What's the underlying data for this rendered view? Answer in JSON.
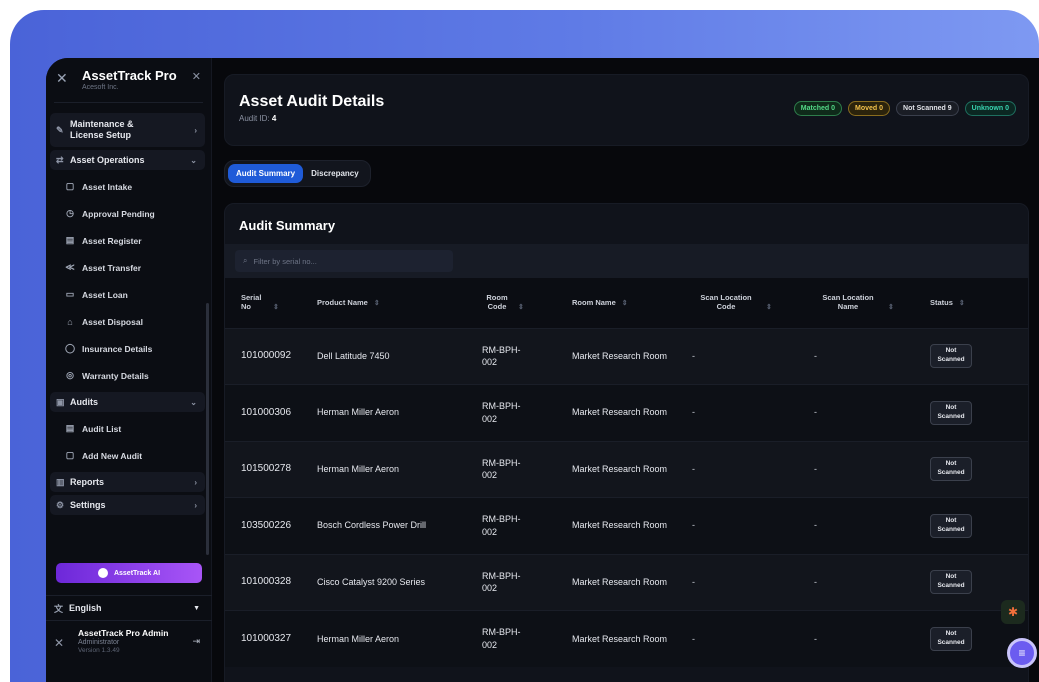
{
  "sidebar": {
    "brand_title": "AssetTrack Pro",
    "brand_sub": "Acesoft Inc.",
    "groups": {
      "maintenance": "Maintenance & License Setup",
      "operations": "Asset Operations",
      "audits": "Audits",
      "reports": "Reports",
      "settings": "Settings"
    },
    "operations_items": [
      "Asset Intake",
      "Approval Pending",
      "Asset Register",
      "Asset Transfer",
      "Asset Loan",
      "Asset Disposal",
      "Insurance Details",
      "Warranty Details"
    ],
    "audit_items": [
      "Audit List",
      "Add New Audit"
    ],
    "ai_button": "AssetTrack AI",
    "language": "English",
    "user_name": "AssetTrack Pro Admin",
    "user_role": "Administrator",
    "version": "Version 1.3.49"
  },
  "header": {
    "title": "Asset Audit Details",
    "audit_id_label": "Audit ID:",
    "audit_id_value": "4",
    "badges": {
      "matched": "Matched 0",
      "moved": "Moved 0",
      "not_scanned": "Not Scanned 9",
      "unknown": "Unknown 0"
    }
  },
  "tabs": [
    "Audit Summary",
    "Discrepancy"
  ],
  "summary": {
    "title": "Audit Summary",
    "filter_placeholder": "Filter by serial no...",
    "columns": [
      "Serial No",
      "Product Name",
      "Room Code",
      "Room Name",
      "Scan Location Code",
      "Scan Location Name",
      "Status"
    ],
    "rows": [
      {
        "serial": "101000092",
        "product": "Dell Latitude 7450",
        "room_code": "RM-BPH-002",
        "room_name": "Market Research Room",
        "scan_code": "-",
        "scan_name": "-",
        "status": "Not Scanned"
      },
      {
        "serial": "101000306",
        "product": "Herman Miller Aeron",
        "room_code": "RM-BPH-002",
        "room_name": "Market Research Room",
        "scan_code": "-",
        "scan_name": "-",
        "status": "Not Scanned"
      },
      {
        "serial": "101500278",
        "product": "Herman Miller Aeron",
        "room_code": "RM-BPH-002",
        "room_name": "Market Research Room",
        "scan_code": "-",
        "scan_name": "-",
        "status": "Not Scanned"
      },
      {
        "serial": "103500226",
        "product": "Bosch Cordless Power Drill",
        "room_code": "RM-BPH-002",
        "room_name": "Market Research Room",
        "scan_code": "-",
        "scan_name": "-",
        "status": "Not Scanned"
      },
      {
        "serial": "101000328",
        "product": "Cisco Catalyst 9200 Series",
        "room_code": "RM-BPH-002",
        "room_name": "Market Research Room",
        "scan_code": "-",
        "scan_name": "-",
        "status": "Not Scanned"
      },
      {
        "serial": "101000327",
        "product": "Herman Miller Aeron",
        "room_code": "RM-BPH-002",
        "room_name": "Market Research Room",
        "scan_code": "-",
        "scan_name": "-",
        "status": "Not Scanned"
      }
    ]
  },
  "colors": {
    "accent": "#1f5bd8",
    "ai_gradient_start": "#6d28d9",
    "ai_gradient_end": "#a855f7",
    "background_gradient_start": "#4a63d8",
    "background_gradient_end": "#7e99f2"
  },
  "icons": {
    "logo": "x-logo-icon",
    "close": "close-icon",
    "wrench": "wrench-icon",
    "swap": "swap-icon",
    "document": "document-icon",
    "clock": "clock-icon",
    "register": "register-icon",
    "share": "share-icon",
    "card": "card-icon",
    "trash": "trash-icon",
    "shield": "shield-icon",
    "clipboard": "clipboard-icon",
    "chart": "chart-icon",
    "gear": "gear-icon",
    "language": "language-icon",
    "logout": "logout-icon",
    "search": "search-icon",
    "sort": "sort-icon",
    "bug": "bug-icon",
    "menu": "menu-icon"
  }
}
